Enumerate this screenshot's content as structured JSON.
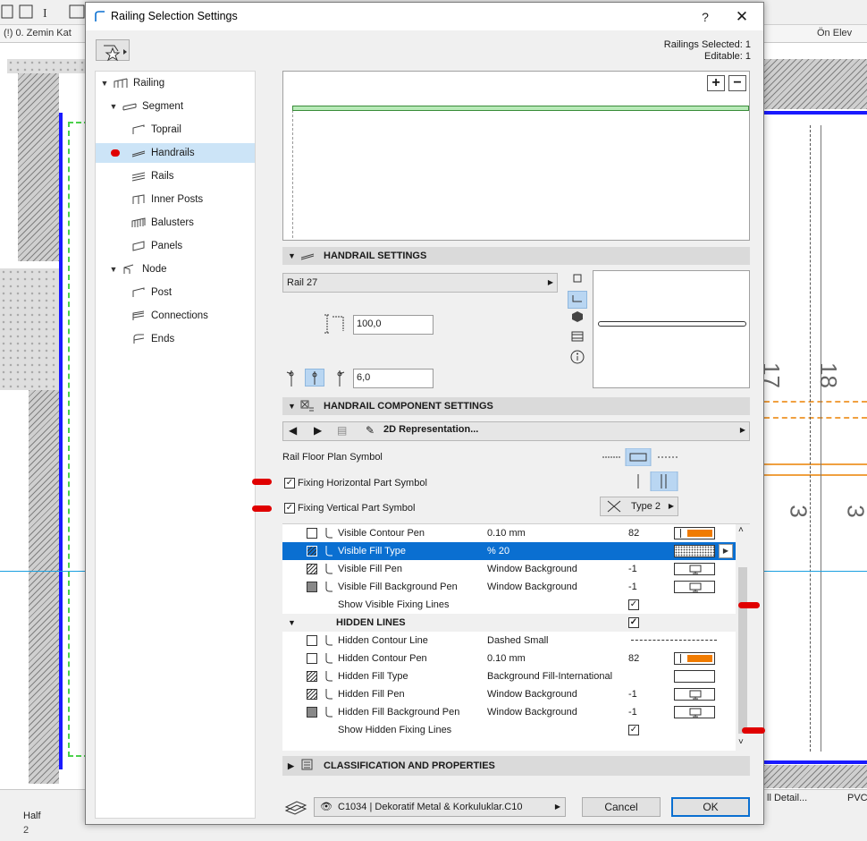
{
  "background": {
    "tab_left": "(!) 0. Zemin Kat",
    "tab_right": "Ön Elev",
    "bottom_half_label": "Half",
    "bottom_half_value": "2",
    "bottom_detail": "ll Detail...",
    "bottom_pvc": "PVC",
    "grid_numbers": [
      "17",
      "18",
      "3",
      "3"
    ]
  },
  "dialog": {
    "title": "Railing Selection Settings",
    "help_label": "?",
    "close_label": "✕",
    "selection_info": {
      "selected": "Railings Selected: 1",
      "editable": "Editable: 1"
    },
    "tree": [
      {
        "label": "Railing",
        "level": 0,
        "expanded": true
      },
      {
        "label": "Segment",
        "level": 1,
        "expanded": true
      },
      {
        "label": "Toprail",
        "level": 2
      },
      {
        "label": "Handrails",
        "level": 2,
        "selected": true
      },
      {
        "label": "Rails",
        "level": 2
      },
      {
        "label": "Inner Posts",
        "level": 2
      },
      {
        "label": "Balusters",
        "level": 2
      },
      {
        "label": "Panels",
        "level": 2
      },
      {
        "label": "Node",
        "level": 1,
        "expanded": true
      },
      {
        "label": "Post",
        "level": 2
      },
      {
        "label": "Connections",
        "level": 2
      },
      {
        "label": "Ends",
        "level": 2
      }
    ],
    "preview": {
      "zoom_in": "+",
      "zoom_out": "−"
    },
    "handrail_settings": {
      "title": "HANDRAIL SETTINGS",
      "profile": "Rail 27",
      "height_value": "100,0",
      "offset_value": "6,0"
    },
    "component_settings": {
      "title": "HANDRAIL COMPONENT SETTINGS",
      "representation": "2D Representation...",
      "rail_floor_plan_symbol": "Rail Floor Plan Symbol",
      "fixing_horizontal": "Fixing Horizontal Part Symbol",
      "fixing_vertical": "Fixing Vertical Part Symbol",
      "type_value": "Type 2"
    },
    "table_rows": [
      {
        "name": "Visible Contour Pen",
        "value": "0.10 mm",
        "num": "82",
        "swatch": "orange"
      },
      {
        "name": "Visible Fill Type",
        "value": "%  20",
        "num": "",
        "swatch": "pattern",
        "selected": true
      },
      {
        "name": "Visible Fill Pen",
        "value": "Window Background",
        "num": "-1",
        "swatch": "monitor"
      },
      {
        "name": "Visible Fill Background Pen",
        "value": "Window Background",
        "num": "-1",
        "swatch": "monitor"
      },
      {
        "name": "Show Visible Fixing Lines",
        "value": "",
        "num": "",
        "swatch": "check"
      },
      {
        "name": "HIDDEN LINES",
        "value": "",
        "num": "",
        "swatch": "check",
        "group": true
      },
      {
        "name": "Hidden Contour Line",
        "value": "Dashed Small",
        "num": "",
        "swatch": "dashed"
      },
      {
        "name": "Hidden Contour Pen",
        "value": "0.10 mm",
        "num": "82",
        "swatch": "orange"
      },
      {
        "name": "Hidden Fill Type",
        "value": "Background Fill-International",
        "num": "",
        "swatch": "blank"
      },
      {
        "name": "Hidden Fill Pen",
        "value": "Window Background",
        "num": "-1",
        "swatch": "monitor"
      },
      {
        "name": "Hidden Fill Background Pen",
        "value": "Window Background",
        "num": "-1",
        "swatch": "monitor"
      },
      {
        "name": "Show Hidden Fixing Lines",
        "value": "",
        "num": "",
        "swatch": "check"
      }
    ],
    "classification": {
      "title": "CLASSIFICATION AND PROPERTIES"
    },
    "footer": {
      "layer": "C1034 | Dekoratif Metal & Korkuluklar.C10",
      "cancel": "Cancel",
      "ok": "OK"
    }
  },
  "colors": {
    "accent": "#0a6fd1",
    "selection": "#cce4f7",
    "pen_orange": "#f07b00",
    "marker": "#e00000"
  }
}
